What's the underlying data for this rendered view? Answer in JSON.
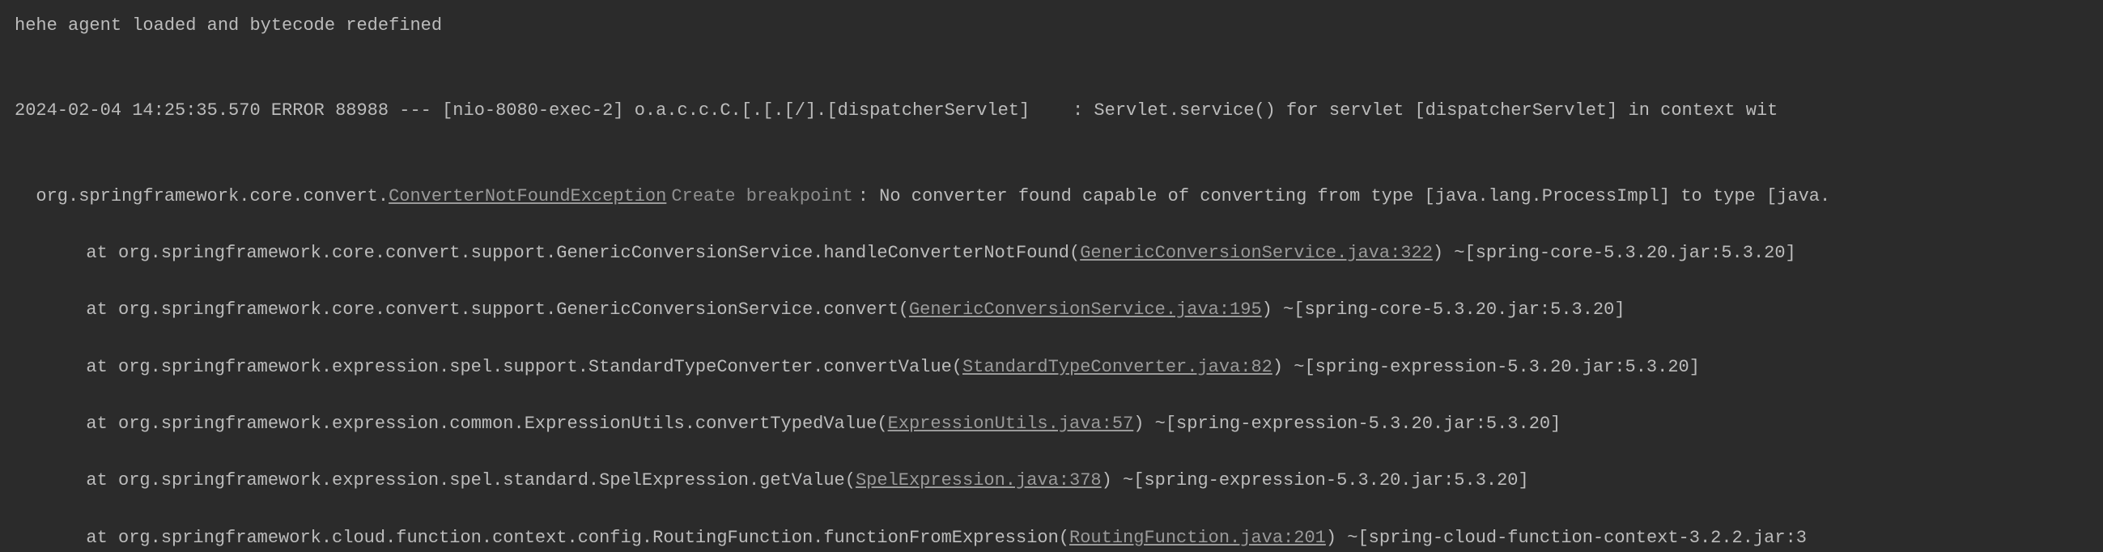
{
  "lines": {
    "msg1": "hehe agent loaded and bytecode redefined",
    "log_prefix": "2024-02-04 14:25:35.570 ERROR 88988 --- [nio-8080-exec-2] o.a.c.c.C.[.[.[/].[dispatcherServlet]    : Servlet.service() for servlet [dispatcherServlet] in context wit",
    "exc_prefix": "org.springframework.core.convert.",
    "exc_class": "ConverterNotFoundException",
    "create_breakpoint": "Create breakpoint",
    "exc_suffix": ": No converter found capable of converting from type [java.lang.ProcessImpl] to type [java.",
    "trace": [
      {
        "pre": "at org.springframework.core.convert.support.GenericConversionService.handleConverterNotFound(",
        "link": "GenericConversionService.java:322",
        "post": ") ~[spring-core-5.3.20.jar:5.3.20]"
      },
      {
        "pre": "at org.springframework.core.convert.support.GenericConversionService.convert(",
        "link": "GenericConversionService.java:195",
        "post": ") ~[spring-core-5.3.20.jar:5.3.20]"
      },
      {
        "pre": "at org.springframework.expression.spel.support.StandardTypeConverter.convertValue(",
        "link": "StandardTypeConverter.java:82",
        "post": ") ~[spring-expression-5.3.20.jar:5.3.20]"
      },
      {
        "pre": "at org.springframework.expression.common.ExpressionUtils.convertTypedValue(",
        "link": "ExpressionUtils.java:57",
        "post": ") ~[spring-expression-5.3.20.jar:5.3.20]"
      },
      {
        "pre": "at org.springframework.expression.spel.standard.SpelExpression.getValue(",
        "link": "SpelExpression.java:378",
        "post": ") ~[spring-expression-5.3.20.jar:5.3.20]"
      },
      {
        "pre": "at org.springframework.cloud.function.context.config.RoutingFunction.functionFromExpression(",
        "link": "RoutingFunction.java:201",
        "post": ") ~[spring-cloud-function-context-3.2.2.jar:3"
      }
    ]
  }
}
